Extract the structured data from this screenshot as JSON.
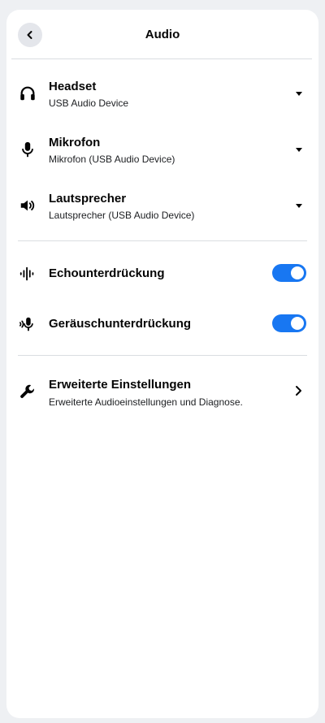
{
  "header": {
    "title": "Audio",
    "back_icon": "chevron-left-icon"
  },
  "devices": [
    {
      "title": "Headset",
      "subtitle": "USB Audio Device",
      "icon": "headphones-icon"
    },
    {
      "title": "Mikrofon",
      "subtitle": "Mikrofon (USB Audio Device)",
      "icon": "microphone-icon"
    },
    {
      "title": "Lautsprecher",
      "subtitle": "Lautsprecher (USB Audio Device)",
      "icon": "speaker-icon"
    }
  ],
  "toggles": [
    {
      "label": "Echounterdrückung",
      "icon": "waveform-icon",
      "enabled": true
    },
    {
      "label": "Geräuschunterdrückung",
      "icon": "noise-suppression-icon",
      "enabled": true
    }
  ],
  "advanced": {
    "title": "Erweiterte Einstellungen",
    "subtitle": "Erweiterte Audioeinstellungen und Diagnose.",
    "icon": "wrench-icon"
  },
  "colors": {
    "accent": "#1877f2",
    "background": "#eef0f3",
    "panel": "#ffffff"
  }
}
